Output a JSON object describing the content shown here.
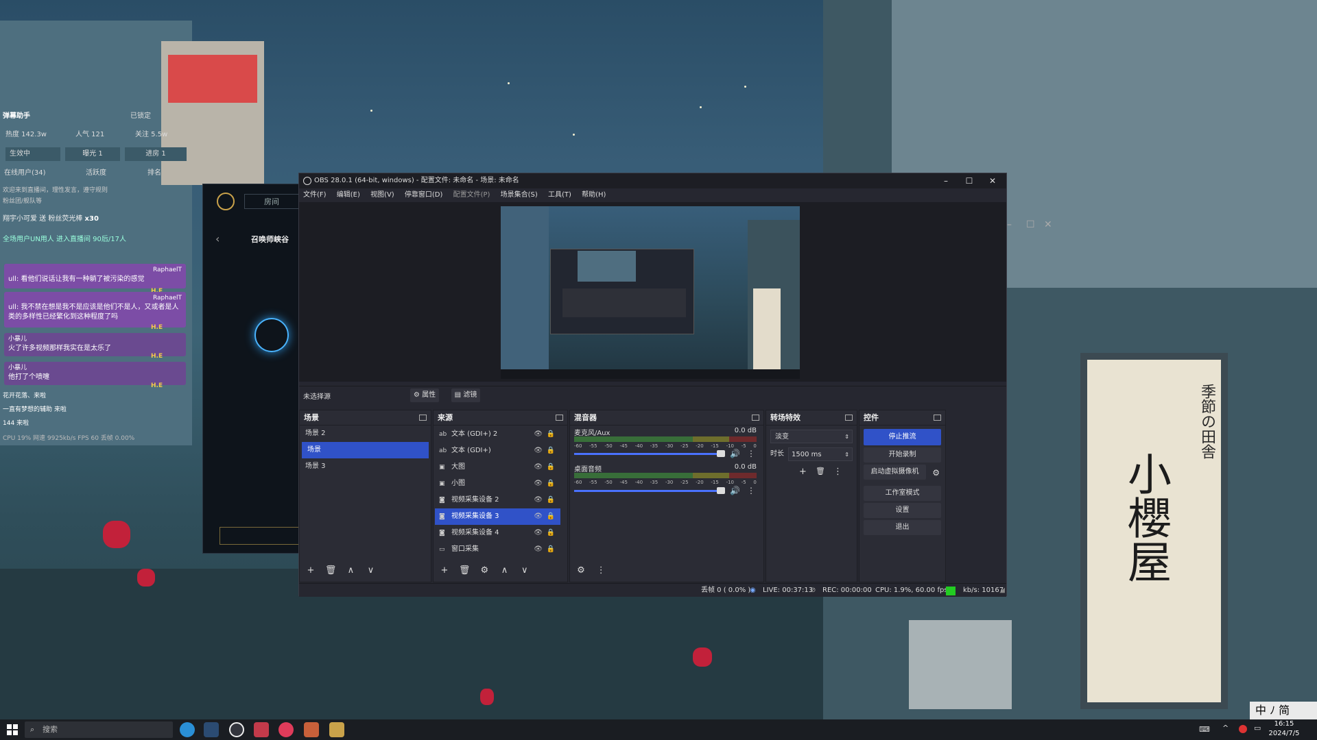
{
  "chat_overlay": {
    "title": "弹幕助手",
    "title_right": "已锁定",
    "stats": [
      "热度 142.3w",
      "人气 121",
      "关注 5.5w"
    ],
    "live_status": "生效中",
    "exposure": "曝光 1",
    "entered": "进房 1",
    "online": "在线用户(34)",
    "activity": "活跃度",
    "ranking": "排名",
    "notice1": "欢迎来到直播间，理性发言，遵守规则",
    "notice2": "粉丝团/舰队等",
    "gift_line": "翔宇小可爱 送 粉丝荧光棒",
    "gift_count": "x30",
    "enter_line": "全场用户UN用人 进入直播间  90后/17人",
    "messages": [
      {
        "user": "RaphaelT",
        "text": "ull: 看他们说话让我有一种躺了被污染的感觉",
        "tag": "H.E"
      },
      {
        "user": "RaphaelT",
        "text": "ull: 我不禁在想是我不是应该是他们不是人，又或者是人类的多样性已经繁化到这种程度了吗",
        "tag": "H.E"
      },
      {
        "user": "小暴儿",
        "text": "火了许多视频那样我实在是太乐了",
        "tag": "H.E"
      },
      {
        "user": "小暴儿",
        "text": "他打了个喷嚏",
        "tag": "H.E"
      }
    ],
    "bottom_lines": [
      "花开花落、来啦",
      "一直有梦想的辅助 来啦",
      "144 来啦"
    ],
    "bottom_stats": "CPU 19%   网速 9925kb/s  FPS 60    丢帧 0.00%"
  },
  "client": {
    "tab_label": "房间",
    "summoner_label": "召唤师峡谷"
  },
  "obs": {
    "title": "OBS 28.0.1 (64-bit, windows) - 配置文件: 未命名 - 场景: 未命名",
    "menu": [
      "文件(F)",
      "编辑(E)",
      "视图(V)",
      "停靠窗口(D)",
      "配置文件(P)",
      "场景集合(S)",
      "工具(T)",
      "帮助(H)"
    ],
    "source_bar": {
      "no_source": "未选择源",
      "properties": "属性",
      "filters": "滤镜"
    },
    "scenes": {
      "title": "场景",
      "items": [
        "场景 2",
        "场景",
        "场景 3"
      ],
      "selected": 1
    },
    "sources": {
      "title": "来源",
      "items": [
        "文本 (GDI+) 2",
        "文本 (GDI+)",
        "大图",
        "小图",
        "视频采集设备 2",
        "视频采集设备 3",
        "视频采集设备 4",
        "窗口采集"
      ],
      "icons": [
        "text-icon",
        "text-icon",
        "image-icon",
        "image-icon",
        "camera-icon",
        "camera-icon",
        "camera-icon",
        "window-icon"
      ],
      "selected": 5
    },
    "mixer": {
      "title": "混音器",
      "ticks": [
        "-60",
        "-55",
        "-50",
        "-45",
        "-40",
        "-35",
        "-30",
        "-25",
        "-20",
        "-15",
        "-10",
        "-5",
        "0"
      ],
      "channels": [
        {
          "name": "麦克风/Aux",
          "db": "0.0 dB",
          "volume": 1.0
        },
        {
          "name": "桌面音频",
          "db": "0.0 dB",
          "volume": 1.0
        }
      ]
    },
    "transitions": {
      "title": "转场特效",
      "type": "淡变",
      "duration_label": "时长",
      "duration": "1500 ms"
    },
    "controls": {
      "title": "控件",
      "buttons": [
        "停止推流",
        "开始录制",
        "启动虚拟摄像机",
        "工作室模式",
        "设置",
        "退出"
      ]
    },
    "status": {
      "dropped": "丢帧 0 ( 0.0% )",
      "live": "LIVE: 00:37:13",
      "rec": "REC: 00:00:00",
      "cpu": "CPU: 1.9%, 60.00 fps",
      "kbps": "kb/s: 10167"
    },
    "colors": {
      "accent": "#3052c8",
      "status_ok": "#22cc22"
    }
  },
  "taskbar": {
    "search_placeholder": "搜索",
    "time": "16:15",
    "date": "2024/7/5",
    "ime": "中 ﾉ 简"
  },
  "signboard": {
    "text": "小櫻屋",
    "side": "季節の田舎"
  }
}
